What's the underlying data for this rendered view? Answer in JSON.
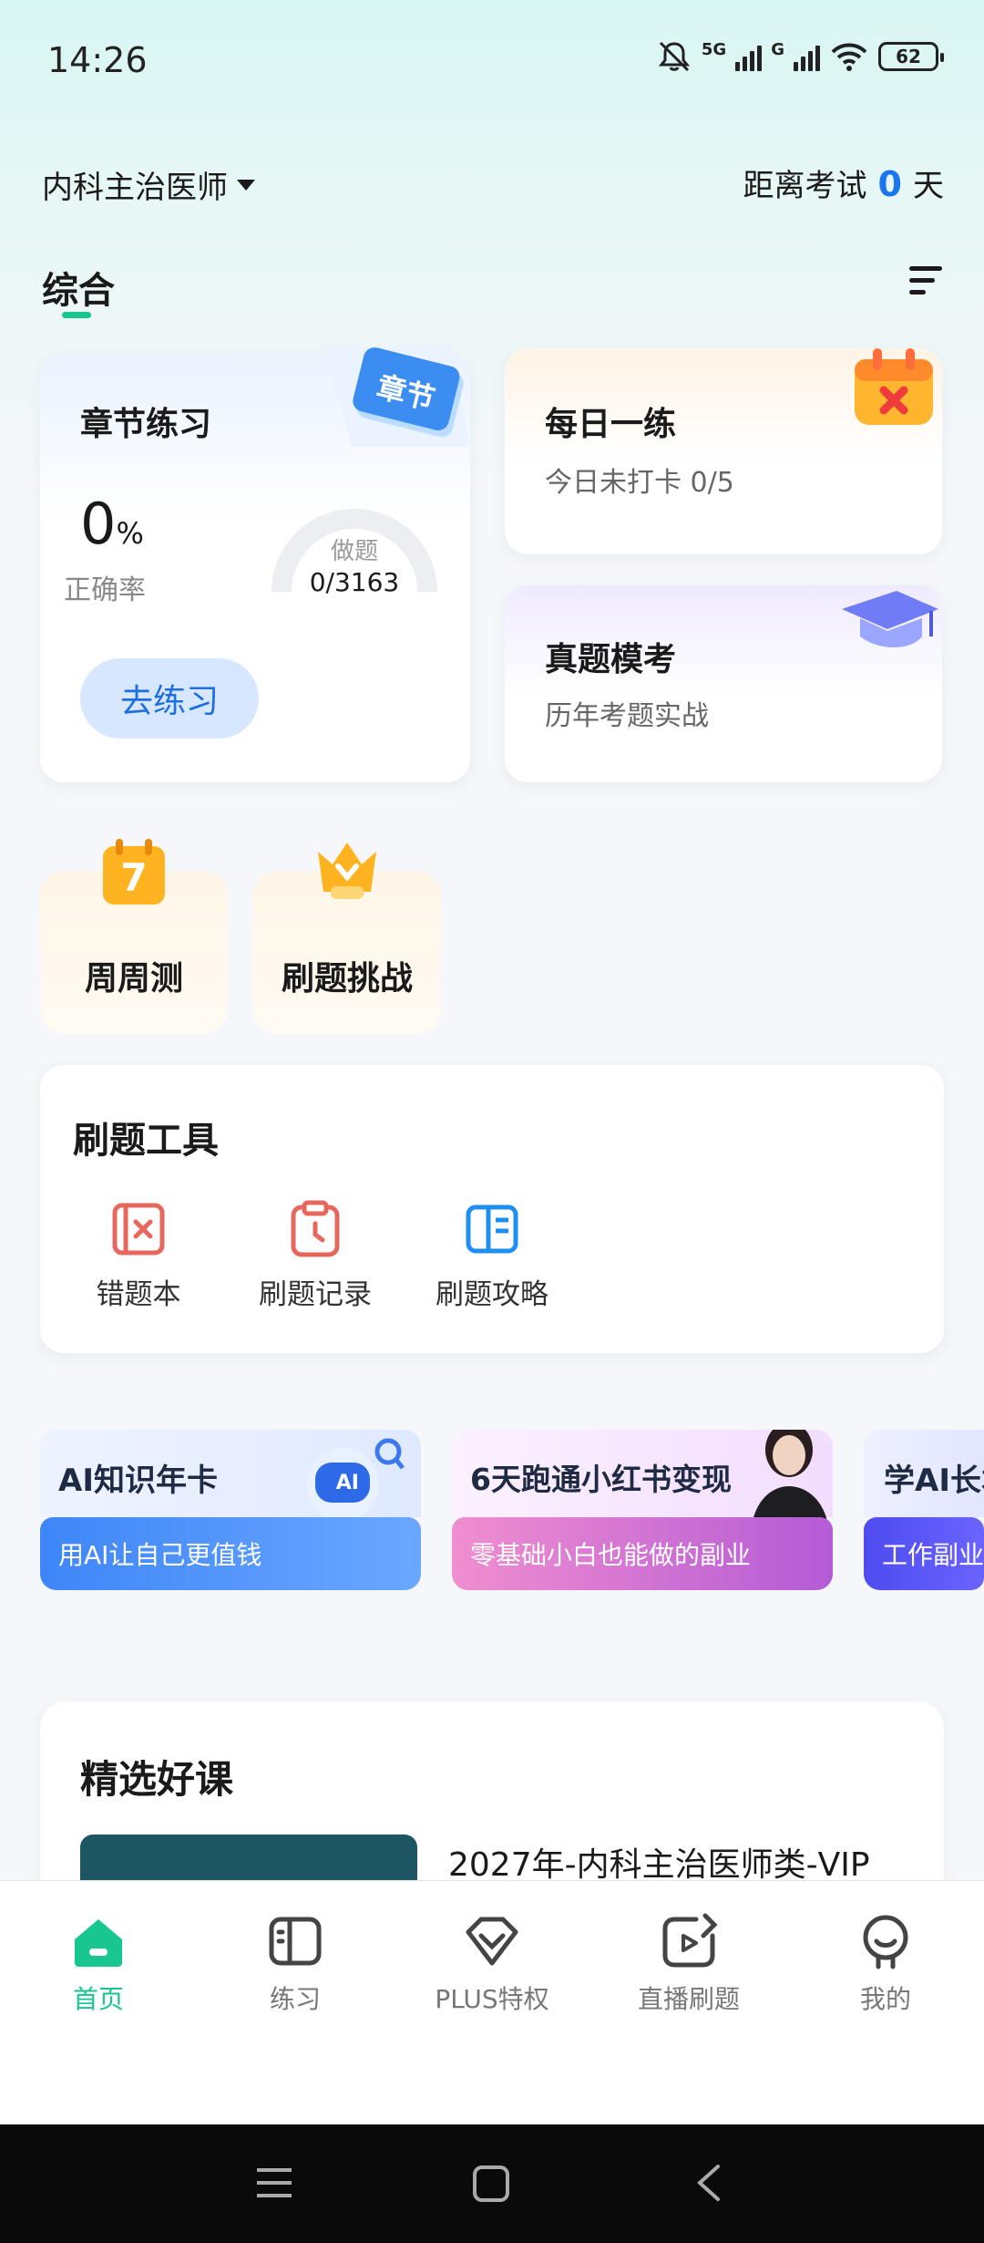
{
  "status_bar": {
    "time": "14:26",
    "net1": "5G",
    "net2": "G",
    "battery": "62"
  },
  "header": {
    "exam_name": "内科主治医师",
    "countdown_prefix": "距离考试",
    "countdown_days": "0",
    "countdown_suffix": "天"
  },
  "tabs": {
    "active": "综合"
  },
  "chapter_practice": {
    "title": "章节练习",
    "badge": "章节",
    "accuracy_value": "0",
    "accuracy_unit": "%",
    "accuracy_label": "正确率",
    "done_label": "做题",
    "done_value": "0/3163",
    "button": "去练习"
  },
  "daily_practice": {
    "title": "每日一练",
    "subtitle": "今日未打卡 0/5"
  },
  "mock_exam": {
    "title": "真题模考",
    "subtitle": "历年考题实战"
  },
  "mini_cards": {
    "weekly": {
      "label": "周周测",
      "icon_number": "7"
    },
    "challenge": {
      "label": "刷题挑战"
    }
  },
  "tools": {
    "title": "刷题工具",
    "items": [
      {
        "label": "错题本",
        "icon": "wrong-book-icon"
      },
      {
        "label": "刷题记录",
        "icon": "clipboard-clock-icon"
      },
      {
        "label": "刷题攻略",
        "icon": "guide-book-icon"
      }
    ]
  },
  "banners": [
    {
      "title": "AI知识年卡",
      "subtitle": "用AI让自己更值钱",
      "badge": "AI"
    },
    {
      "title": "6天跑通小红书变现",
      "subtitle": "零基础小白也能做的副业"
    },
    {
      "title": "学AI长本",
      "subtitle": "工作副业"
    }
  ],
  "courses": {
    "title": "精选好课",
    "first_course_name": "2027年-内科主治医师类-VIP"
  },
  "bottom_nav": [
    {
      "label": "首页",
      "active": true
    },
    {
      "label": "练习",
      "active": false
    },
    {
      "label": "PLUS特权",
      "active": false
    },
    {
      "label": "直播刷题",
      "active": false
    },
    {
      "label": "我的",
      "active": false
    }
  ],
  "colors": {
    "accent_green": "#19c68f",
    "accent_blue": "#1976f0",
    "practice_button_bg": "#d6e7ff"
  }
}
